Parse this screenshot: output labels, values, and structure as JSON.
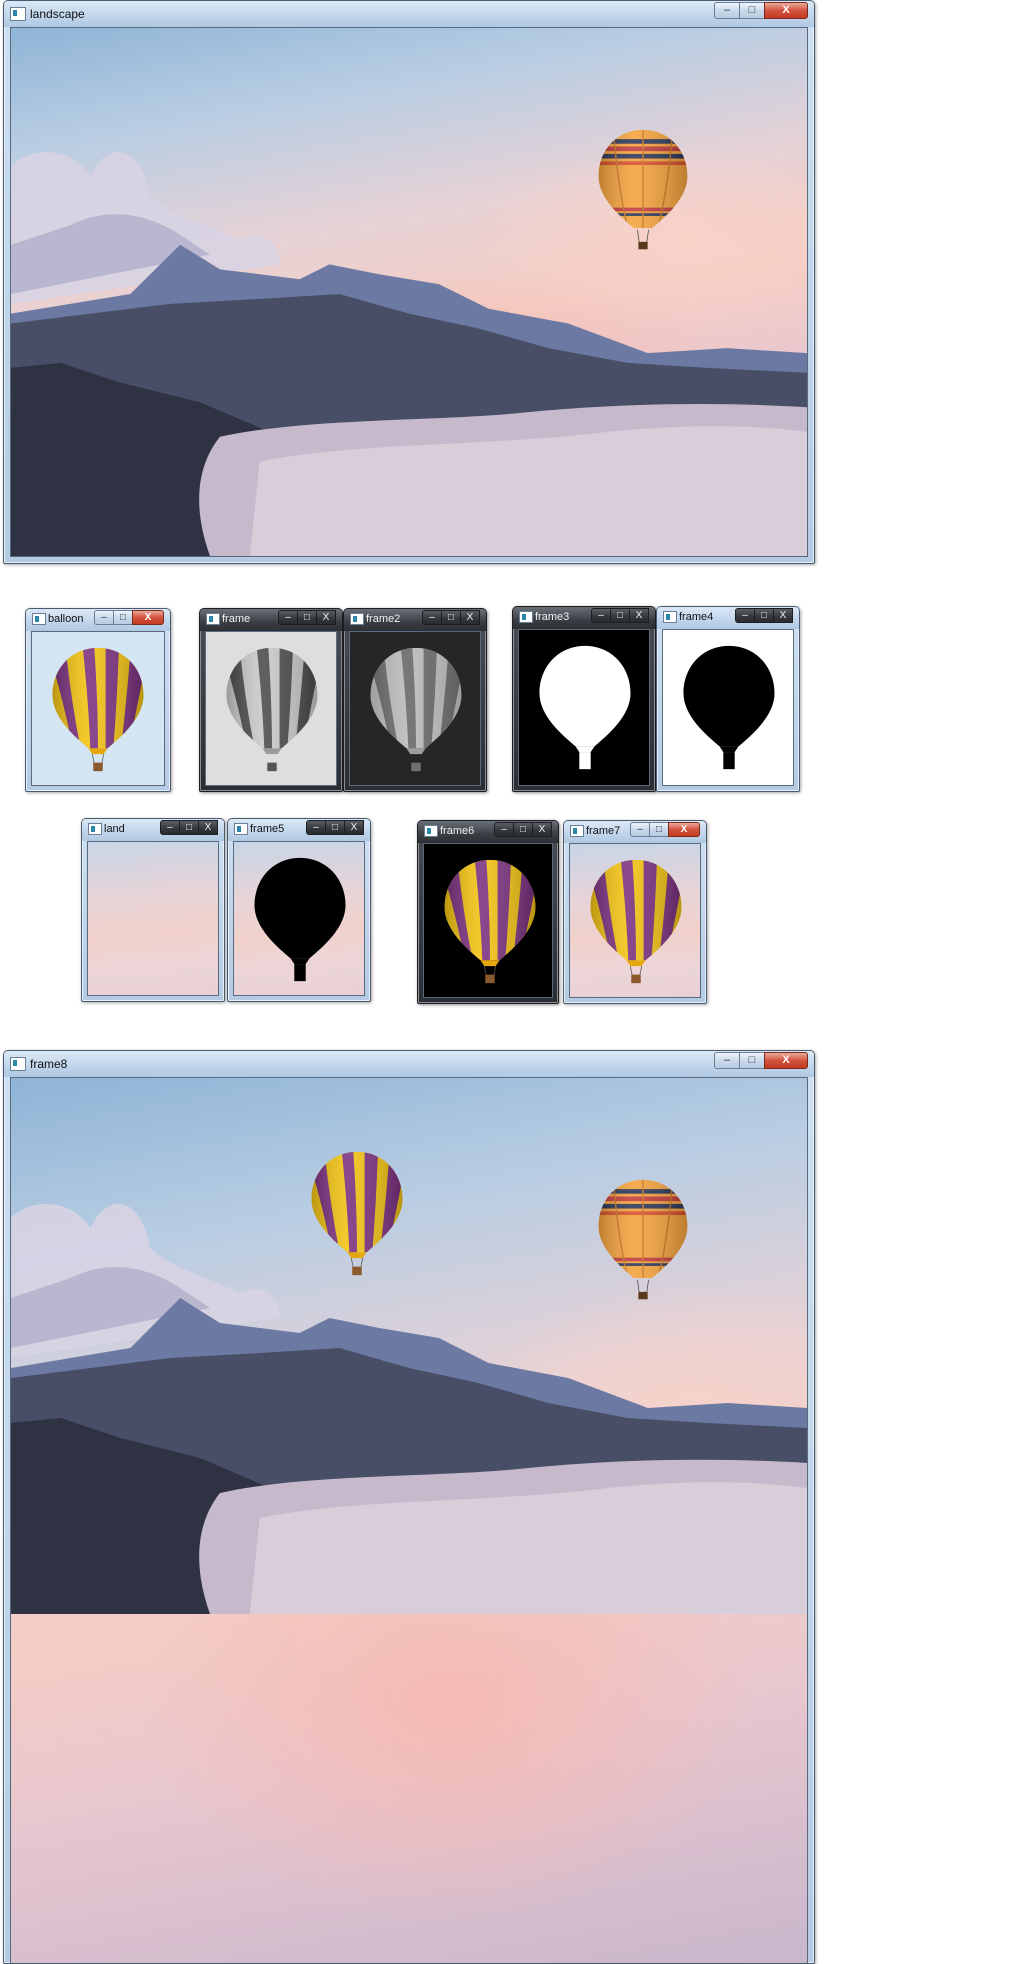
{
  "windows": {
    "landscape": {
      "title": "landscape"
    },
    "balloon": {
      "title": "balloon"
    },
    "frame": {
      "title": "frame"
    },
    "frame2": {
      "title": "frame2"
    },
    "frame3": {
      "title": "frame3"
    },
    "frame4": {
      "title": "frame4"
    },
    "land": {
      "title": "land"
    },
    "frame5": {
      "title": "frame5"
    },
    "frame6": {
      "title": "frame6"
    },
    "frame7": {
      "title": "frame7"
    },
    "frame8": {
      "title": "frame8"
    }
  },
  "controls": {
    "minimize": "–",
    "maximize": "□",
    "close": "X"
  },
  "colors": {
    "balloon_purple": "#7a2f7e",
    "balloon_yellow": "#f2c20f",
    "balloon_orange": "#f08a1c",
    "mountain_dark": "#3d4356",
    "close_red": "#c9432b"
  },
  "icons": [
    "app-window-icon",
    "minimize-icon",
    "maximize-icon",
    "close-icon"
  ]
}
